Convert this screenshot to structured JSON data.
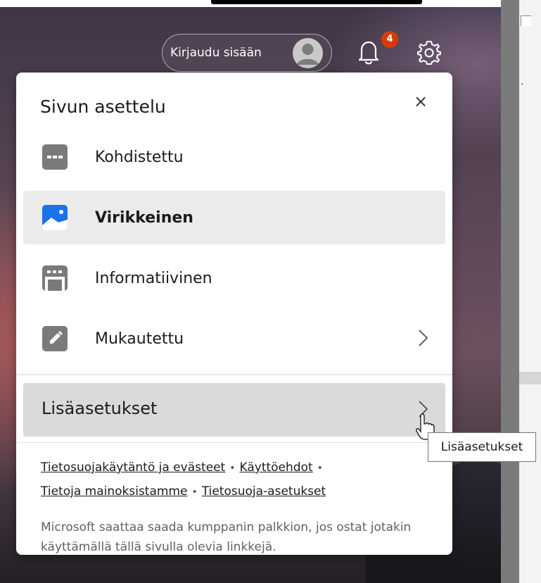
{
  "header": {
    "signin_label": "Kirjaudu sisään",
    "notification_count": "4"
  },
  "flyout": {
    "title": "Sivun asettelu",
    "close_label": "×",
    "options": [
      {
        "label": "Kohdistettu",
        "icon": "focused-layout-icon",
        "selected": false,
        "has_chevron": false
      },
      {
        "label": "Virikkeinen",
        "icon": "inspirational-layout-icon",
        "selected": true,
        "has_chevron": false
      },
      {
        "label": "Informatiivinen",
        "icon": "informational-layout-icon",
        "selected": false,
        "has_chevron": false
      },
      {
        "label": "Mukautettu",
        "icon": "custom-layout-icon",
        "selected": false,
        "has_chevron": true
      }
    ],
    "more_settings_label": "Lisäasetukset",
    "links": [
      "Tietosuojakäytäntö ja evästeet",
      "Käyttöehdot",
      "Tietoja mainoksistamme",
      "Tietosuoja-asetukset"
    ],
    "link_separator": "•",
    "disclaimer": "Microsoft saattaa saada kumppanin palkkion, jos ostat jotakin käyttämällä tällä sivulla olevia linkkejä."
  },
  "tooltip": {
    "text": "Lisäasetukset"
  },
  "colors": {
    "badge": "#d83b01",
    "selected_row": "#ebebeb",
    "hover_row": "#dadada",
    "inspirational_icon": "#1a73e8",
    "neutral_icon": "#7a7a7a"
  }
}
